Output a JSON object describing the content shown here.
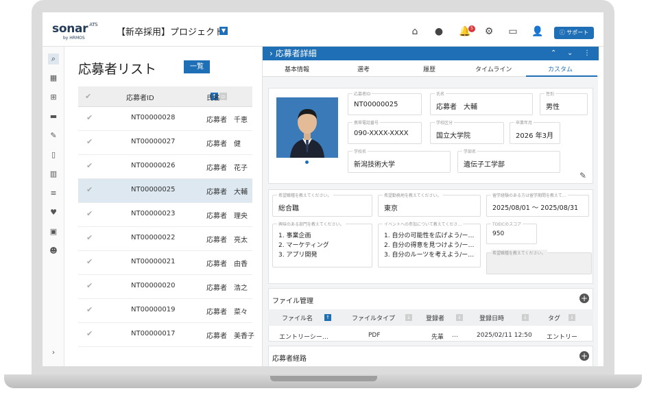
{
  "topbar": {
    "logo": "sonar",
    "logo_ats": "ATS",
    "logo_sub": "by HRMOS",
    "project": "【新卒採用】プロジェクト",
    "notification_count": "5",
    "support_label": "サポート"
  },
  "list": {
    "title": "応募者リスト",
    "view_button": "一覧",
    "col_id": "応募者ID",
    "col_name": "氏名",
    "rows": [
      {
        "id": "NT00000028",
        "name": "応募者　千恵"
      },
      {
        "id": "NT00000027",
        "name": "応募者　健"
      },
      {
        "id": "NT00000026",
        "name": "応募者　花子"
      },
      {
        "id": "NT00000025",
        "name": "応募者　大輔"
      },
      {
        "id": "NT00000023",
        "name": "応募者　理央"
      },
      {
        "id": "NT00000022",
        "name": "応募者　亮太"
      },
      {
        "id": "NT00000021",
        "name": "応募者　由香"
      },
      {
        "id": "NT00000020",
        "name": "応募者　浩之"
      },
      {
        "id": "NT00000019",
        "name": "応募者　菜々"
      },
      {
        "id": "NT00000017",
        "name": "応募者　美香子"
      }
    ]
  },
  "detail": {
    "header": "応募者詳細",
    "tabs": [
      "基本情報",
      "選考",
      "履歴",
      "タイムライン",
      "カスタム"
    ],
    "fields": {
      "applicant_id_label": "応募者ID",
      "applicant_id": "NT00000025",
      "name_label": "氏名",
      "name": "応募者　大輔",
      "gender_label": "性別",
      "gender": "男性",
      "phone_label": "携帯電話番号",
      "phone": "090-XXXX-XXXX",
      "school_type_label": "学校区分",
      "school_type": "国立大学院",
      "grad_label": "卒業年月",
      "grad": "2026 年3月",
      "school_label": "学校名",
      "school": "新潟技術大学",
      "faculty_label": "学部名",
      "faculty": "遺伝子工学部",
      "industry_label": "希望職種を教えてください。",
      "industry": "総合職",
      "location_label": "希望勤務地を教えてください。",
      "location": "東京",
      "study_abroad_label": "留学経験のある方は留学期間を教えて…",
      "study_abroad": "2025/08/01 〜 2025/08/31",
      "interest_label": "興味のある部門を教えてください。",
      "interest": [
        "1. 事業企画",
        "2. マーケティング",
        "3. アプリ開発"
      ],
      "event_label": "イベントへの参加について教えてくださ…",
      "event": [
        "1. 自分の可能性を広げよう/ー…",
        "2. 自分の得意を見つけよう/ー…",
        "3. 自分のルーツを考えよう/ー…"
      ],
      "toeic_label": "TOEICのスコア",
      "toeic": "950",
      "extra_label": "希望職種を教えてください。"
    },
    "files": {
      "title": "ファイル管理",
      "col_name": "ファイル名",
      "col_type": "ファイルタイプ",
      "col_user": "登録者",
      "col_date": "登録日時",
      "col_tag": "タグ",
      "row_name": "エントリーシー…",
      "row_type": "PDF",
      "row_user": "先輩",
      "row_more": "…",
      "row_date": "2025/02/11 12:50",
      "row_tag": "エントリー"
    },
    "route_title": "応募者経路"
  }
}
